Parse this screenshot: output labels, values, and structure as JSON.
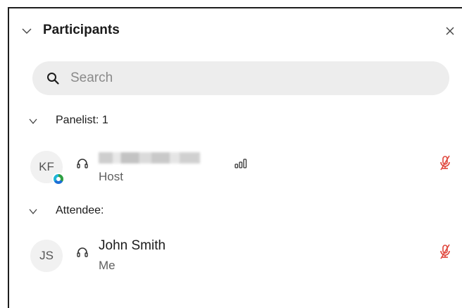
{
  "header": {
    "title": "Participants"
  },
  "search": {
    "placeholder": "Search",
    "value": ""
  },
  "sections": [
    {
      "label": "Panelist: 1",
      "participants": [
        {
          "initials": "KF",
          "name": "",
          "name_redacted": true,
          "role": "Host",
          "mic_status": "muted",
          "audio": "headset",
          "has_status_badge": true
        }
      ]
    },
    {
      "label": "Attendee:",
      "participants": [
        {
          "initials": "JS",
          "name": "John Smith",
          "role": "Me",
          "mic_status": "muted",
          "audio": "headset",
          "has_status_badge": false
        }
      ]
    }
  ],
  "colors": {
    "muted_mic": "#e0463c",
    "search_bg": "#ededed",
    "avatar_bg": "#f1f1f1"
  },
  "icons": [
    "collapse-chevron-icon",
    "close-icon",
    "search-icon",
    "section-chevron-icon",
    "headset-icon",
    "signal-strength-icon",
    "mic-muted-icon"
  ]
}
